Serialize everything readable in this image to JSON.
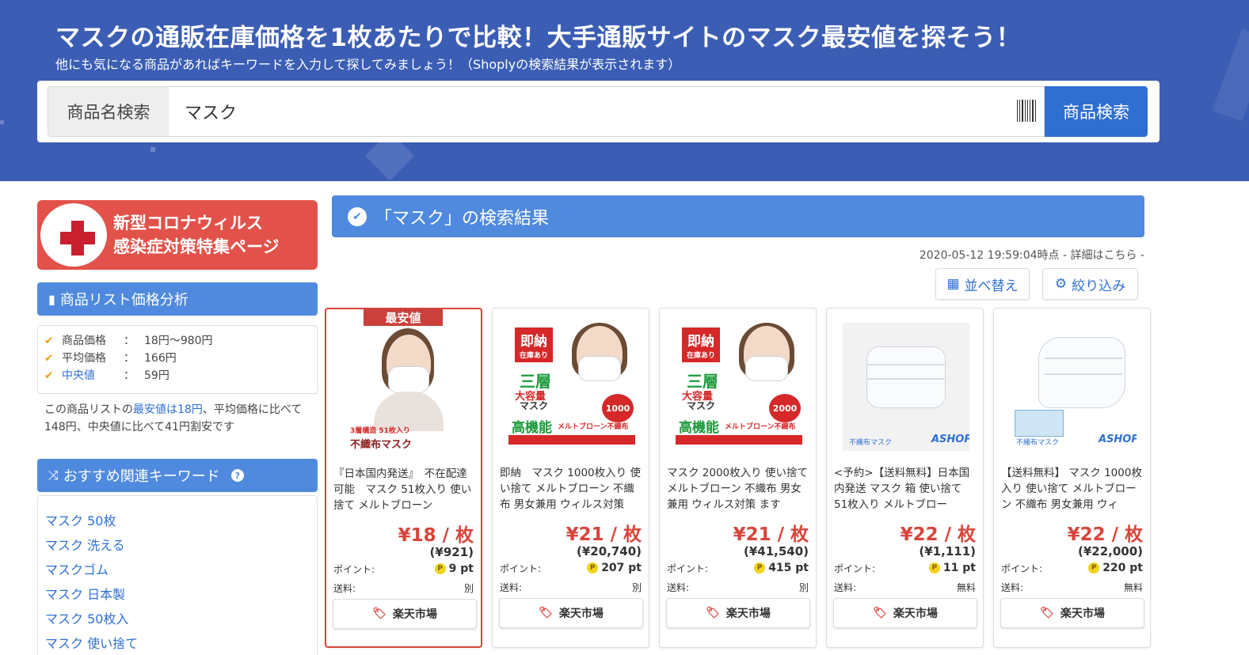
{
  "header": {
    "title": "マスクの通販在庫価格を1枚あたりで比較！大手通販サイトのマスク最安値を探そう！",
    "subtitle": "他にも気になる商品があればキーワードを入力して探してみましょう！（Shoplyの検索結果が表示されます）",
    "search_label": "商品名検索",
    "search_value": "マスク",
    "search_button": "商品検索",
    "colors": {
      "background": "#3b5db4",
      "button": "#2f6fd1"
    }
  },
  "sidebar": {
    "banner_line1": "新型コロナウィルス",
    "banner_line2": "感染症対策特集ページ",
    "analysis_heading": "商品リスト価格分析",
    "stats": [
      {
        "label": "商品価格",
        "value": "18円～980円"
      },
      {
        "label": "平均価格",
        "value": "166円"
      },
      {
        "label": "中央値",
        "value": "59円"
      }
    ],
    "summary_prefix": "この商品リストの",
    "summary_highlight": "最安値は18円",
    "summary_suffix": "、平均価格に比べて148円、中央値に比べて41円割安です",
    "keywords_heading": "おすすめ関連キーワード",
    "keywords": [
      "マスク 50枚",
      "マスク 洗える",
      "マスクゴム",
      "マスク 日本製",
      "マスク 50枚入",
      "マスク 使い捨て"
    ]
  },
  "results": {
    "heading": "「マスク」の検索結果",
    "timestamp": "2020-05-12 19:59:04時点 - 詳細はこちら -",
    "sort_button": "並べ替え",
    "filter_button": "絞り込み",
    "best_badge": "最安値",
    "point_label": "ポイント:",
    "shipping_label": "送料:",
    "products": [
      {
        "title": "『日本国内発送』　不在配達可能　マスク 51枚入り 使い捨て メルトブローン",
        "price": "¥18 / 枚",
        "total": "(¥921)",
        "points": "9 pt",
        "shipping": "別",
        "shop": "楽天市場",
        "img_label": "3層構造 51枚入り",
        "img_caption": "不織布マスク"
      },
      {
        "title": "即納　マスク 1000枚入り 使い捨て メルトブローン 不織布 男女兼用 ウィルス対策",
        "price": "¥21 / 枚",
        "total": "(¥20,740)",
        "points": "207 pt",
        "shipping": "別",
        "shop": "楽天市場",
        "img_tag": "即納",
        "img_sub": "在庫あり",
        "img_l1": "三層",
        "img_l2": "大容量",
        "img_l3": "マスク",
        "img_count": "1000",
        "img_hi": "高機能",
        "img_melt": "メルトブローン不織布"
      },
      {
        "title": "マスク 2000枚入り 使い捨て メルトブローン 不織布 男女兼用 ウィルス対策 ます",
        "price": "¥21 / 枚",
        "total": "(¥41,540)",
        "points": "415 pt",
        "shipping": "別",
        "shop": "楽天市場",
        "img_tag": "即納",
        "img_sub": "在庫あり",
        "img_l1": "三層",
        "img_l2": "大容量",
        "img_l3": "マスク",
        "img_count": "2000",
        "img_hi": "高機能",
        "img_melt": "メルトブローン不織布"
      },
      {
        "title": "<予約>【送料無料】日本国内発送 マスク 箱 使い捨て 51枚入り メルトブロー",
        "price": "¥22 / 枚",
        "total": "(¥1,111)",
        "points": "11 pt",
        "shipping": "無料",
        "shop": "楽天市場",
        "img_caption": "不織布マスク",
        "img_brand": "ASHOP"
      },
      {
        "title": "【送料無料】 マスク 1000枚入り 使い捨て メルトブローン 不織布 男女兼用 ウィ",
        "price": "¥22 / 枚",
        "total": "(¥22,000)",
        "points": "220 pt",
        "shipping": "無料",
        "shop": "楽天市場",
        "img_caption": "不織布マスク",
        "img_brand": "ASHOP"
      }
    ]
  }
}
